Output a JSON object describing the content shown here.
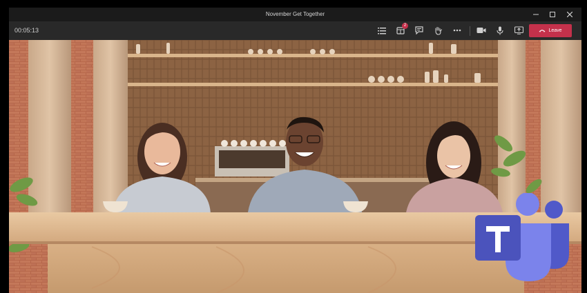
{
  "window": {
    "title": "November Get Together",
    "controls": {
      "minimize_icon": "minimize-icon",
      "maximize_icon": "maximize-icon",
      "close_icon": "close-icon"
    }
  },
  "toolbar": {
    "timer": "00:05:13",
    "participants_icon": "participants-icon",
    "rooms_icon": "breakout-rooms-icon",
    "rooms_badge": "2",
    "chat_icon": "chat-icon",
    "raise_hand_icon": "raise-hand-icon",
    "more_icon": "more-actions-icon",
    "camera_icon": "camera-icon",
    "mic_icon": "microphone-icon",
    "share_icon": "share-screen-icon",
    "leave_label": "Leave",
    "leave_icon": "hang-up-icon"
  },
  "colors": {
    "leave": "#c4314b",
    "toolbar": "#292929",
    "titlebar": "#1b1b1b",
    "teams_purple": "#5059c9"
  },
  "scene": {
    "view": "Together mode",
    "participants": 3
  },
  "logo": {
    "name": "Microsoft Teams logo",
    "letter": "T"
  }
}
